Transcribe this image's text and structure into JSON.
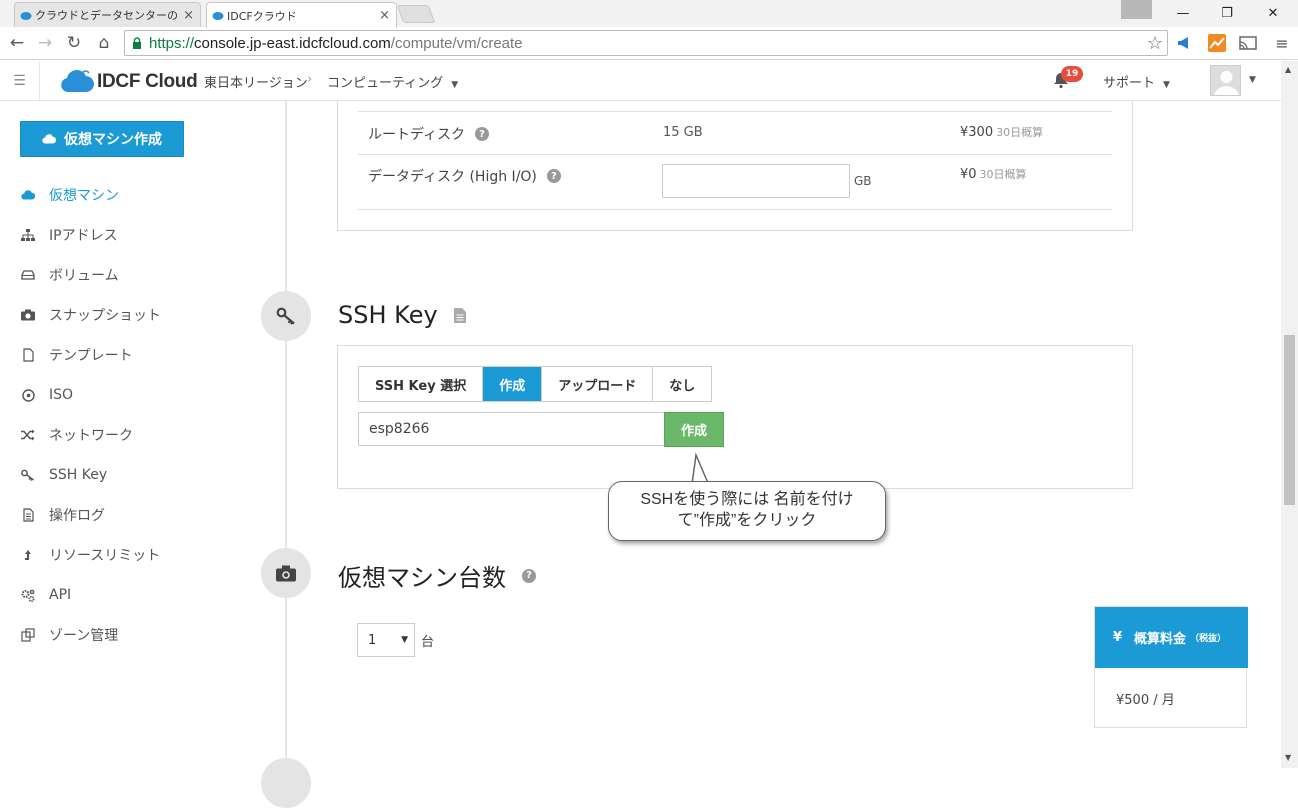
{
  "browser": {
    "tabs": [
      {
        "label": "クラウドとデータセンターのIDCフ",
        "active": false
      },
      {
        "label": "IDCFクラウド",
        "active": true
      }
    ],
    "close_glyph": "×",
    "window_controls": {
      "minimize": "—",
      "restore": "❐",
      "close": "✕"
    },
    "url": {
      "scheme": "https://",
      "host": "console.jp-east.idcfcloud.com",
      "path": "/compute/vm/create"
    }
  },
  "header": {
    "logo_text": "IDCF Cloud",
    "breadcrumb": [
      "東日本リージョン",
      "コンピューティング"
    ],
    "breadcrumb_separator": "›",
    "notification_count": "19",
    "support_label": "サポート"
  },
  "sidebar": {
    "create_button": "仮想マシン作成",
    "items": [
      {
        "label": "仮想マシン",
        "icon": "cloud-icon",
        "active": true
      },
      {
        "label": "IPアドレス",
        "icon": "network-tree-icon",
        "active": false
      },
      {
        "label": "ボリューム",
        "icon": "disk-icon",
        "active": false
      },
      {
        "label": "スナップショット",
        "icon": "camera-icon",
        "active": false
      },
      {
        "label": "テンプレート",
        "icon": "document-icon",
        "active": false
      },
      {
        "label": "ISO",
        "icon": "disc-icon",
        "active": false
      },
      {
        "label": "ネットワーク",
        "icon": "shuffle-icon",
        "active": false
      },
      {
        "label": "SSH Key",
        "icon": "key-icon",
        "active": false
      },
      {
        "label": "操作ログ",
        "icon": "log-icon",
        "active": false
      },
      {
        "label": "リソースリミット",
        "icon": "limit-icon",
        "active": false
      },
      {
        "label": "API",
        "icon": "gears-icon",
        "active": false
      },
      {
        "label": "ゾーン管理",
        "icon": "zone-icon",
        "active": false
      }
    ]
  },
  "disk": {
    "root": {
      "label": "ルートディスク",
      "value": "15 GB",
      "price": "¥300",
      "price_note": "30日概算"
    },
    "data": {
      "label": "データディスク (High I/O)",
      "value": "",
      "unit": "GB",
      "price": "¥0",
      "price_note": "30日概算"
    }
  },
  "ssh": {
    "title": "SSH Key",
    "tabs": [
      {
        "label": "SSH Key 選択",
        "active": false
      },
      {
        "label": "作成",
        "active": true
      },
      {
        "label": "アップロード",
        "active": false
      },
      {
        "label": "なし",
        "active": false
      }
    ],
    "key_name": "esp8266",
    "create_button": "作成"
  },
  "callout": {
    "line1": "SSHを使う際には 名前を付け",
    "line2": "て”作成”をクリック"
  },
  "vm_count": {
    "title": "仮想マシン台数",
    "value": "1",
    "unit": "台"
  },
  "cost": {
    "symbol": "¥",
    "label": "概算料金",
    "tax_note": "（税抜）",
    "value": "¥500 / 月"
  },
  "colors": {
    "accent": "#1b9ad6",
    "success": "#6ab86a",
    "badge": "#e84c3d"
  }
}
